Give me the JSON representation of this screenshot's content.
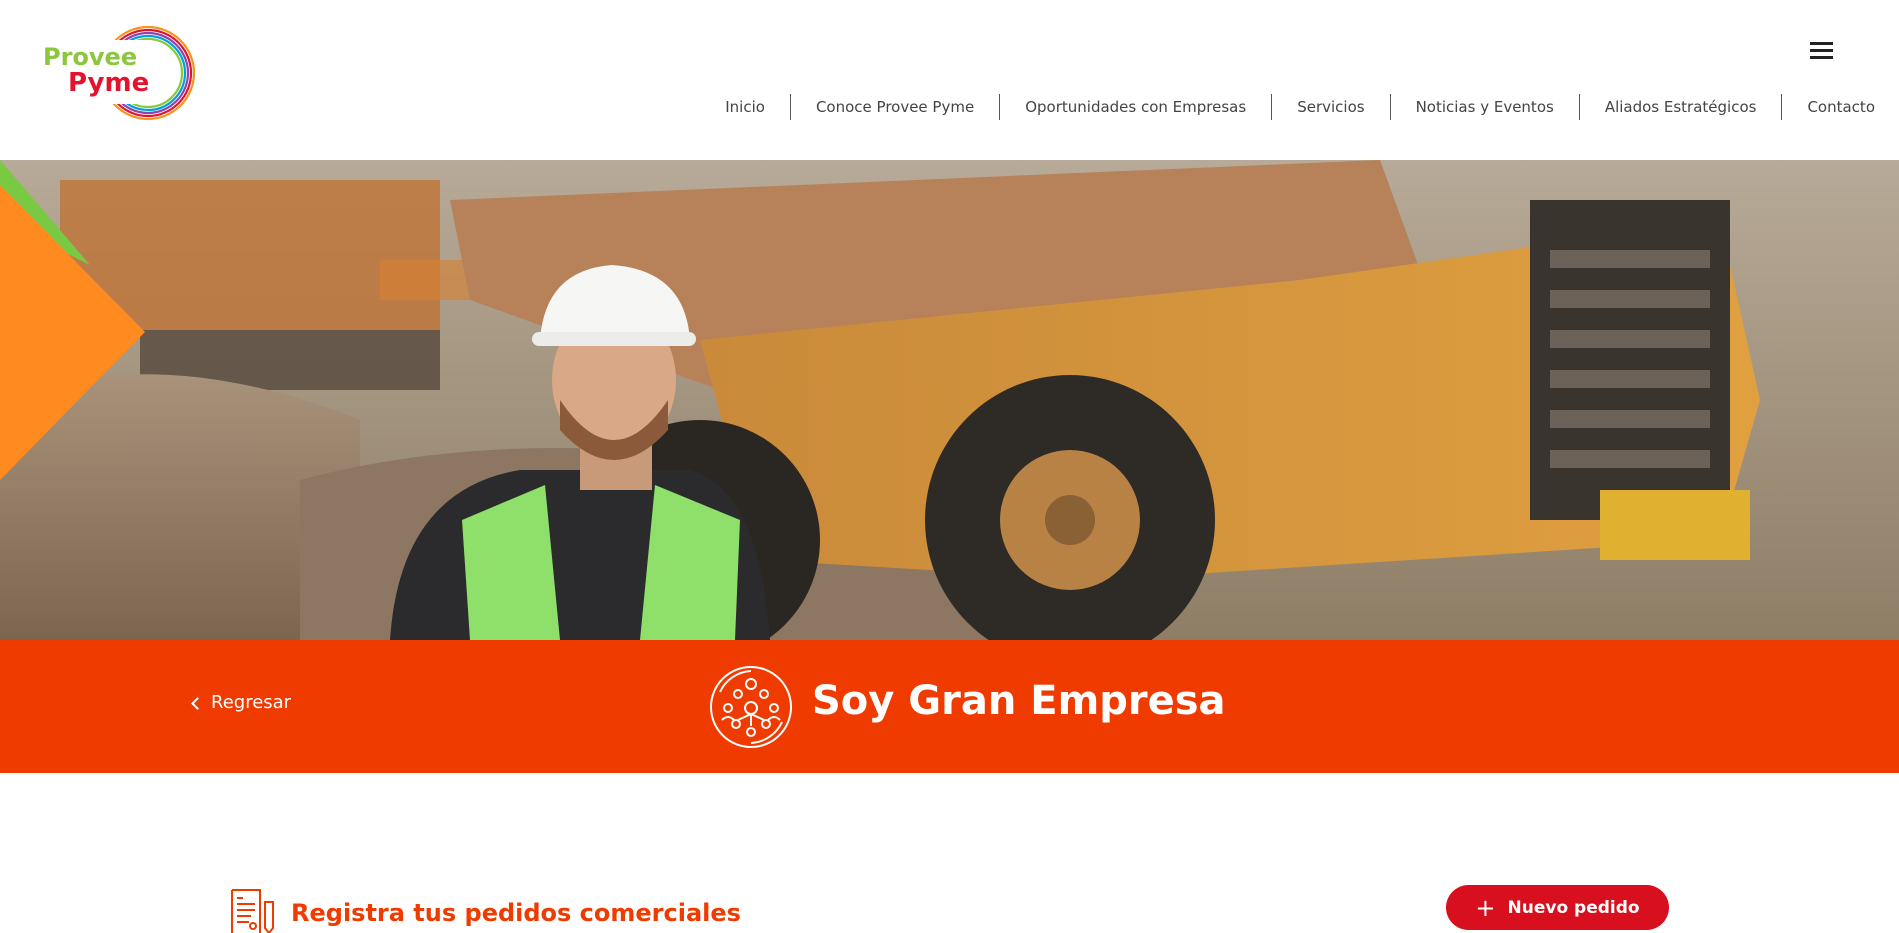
{
  "header": {
    "logo": {
      "line1": "Provee",
      "line2": "Pyme",
      "colors": [
        "#8cc63f",
        "#e3122d",
        "#f7941d",
        "#00a0dc",
        "#8e44ad"
      ]
    },
    "menu_icon": "hamburger-menu-icon",
    "nav": [
      {
        "label": "Inicio"
      },
      {
        "label": "Conoce Provee Pyme"
      },
      {
        "label": "Oportunidades con Empresas"
      },
      {
        "label": "Servicios"
      },
      {
        "label": "Noticias y Eventos"
      },
      {
        "label": "Aliados Estratégicos"
      },
      {
        "label": "Contacto"
      }
    ]
  },
  "hero": {
    "image": "construction-worker-with-mining-truck",
    "accent_colors": {
      "orange": "#ff8a1f",
      "green": "#7ac943"
    }
  },
  "band": {
    "background": "#ef3b00",
    "back_label": "Regresar",
    "back_icon": "chevron-left-icon",
    "icon": "company-network-icon",
    "title": "Soy Gran Empresa"
  },
  "section": {
    "icon": "order-document-icon",
    "title": "Registra tus pedidos comerciales",
    "new_order_button": {
      "label": "Nuevo pedido",
      "icon": "plus-icon",
      "color": "#d70f1e"
    }
  }
}
